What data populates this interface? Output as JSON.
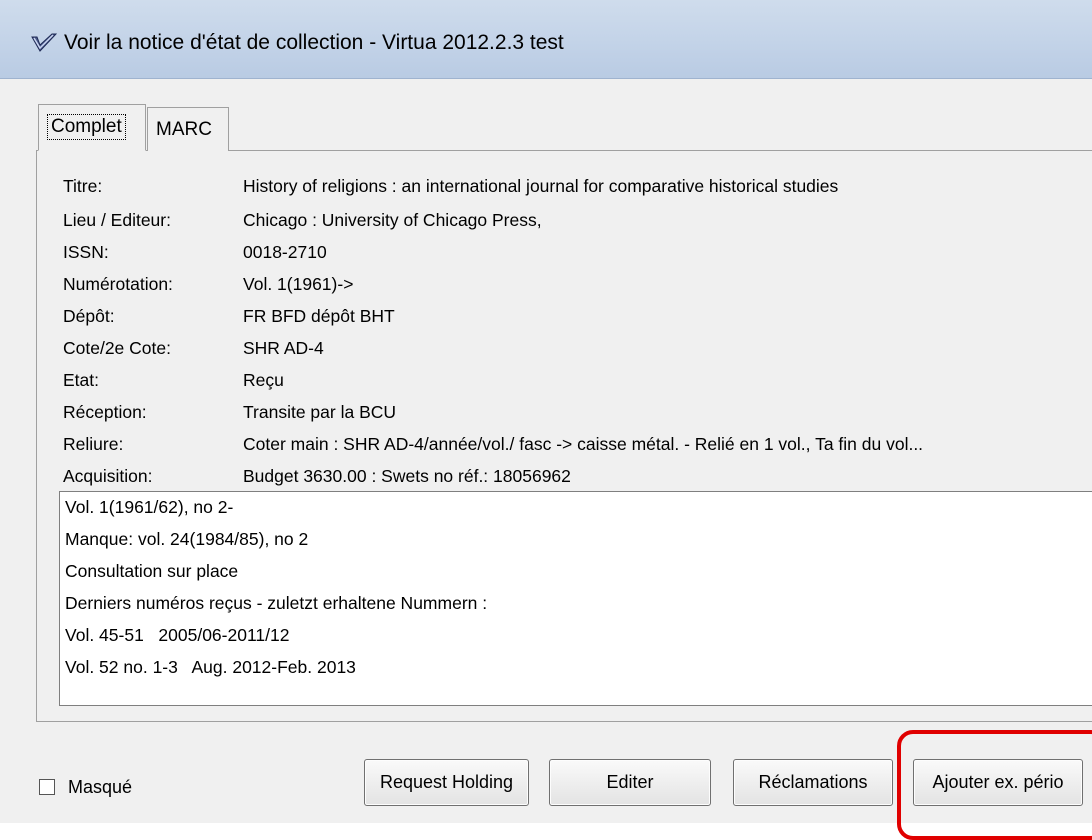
{
  "window": {
    "title": "Voir la notice d'état de collection - Virtua 2012.2.3 test",
    "icon": "virtua-checkmark-icon"
  },
  "tabs": [
    {
      "label": "Complet",
      "selected": true
    },
    {
      "label": "MARC",
      "selected": false
    }
  ],
  "fields": [
    {
      "label": "Titre:",
      "value": "History of religions : an international journal for comparative historical studies"
    },
    {
      "label": "Lieu / Editeur:",
      "value": "Chicago : University of Chicago Press,"
    },
    {
      "label": "ISSN:",
      "value": "0018-2710"
    },
    {
      "label": "Numérotation:",
      "value": "Vol. 1(1961)->"
    },
    {
      "label": "Dépôt:",
      "value": "FR BFD dépôt BHT"
    },
    {
      "label": "Cote/2e Cote:",
      "value": "SHR AD-4"
    },
    {
      "label": "Etat:",
      "value": "Reçu"
    },
    {
      "label": "Réception:",
      "value": "Transite par la BCU"
    },
    {
      "label": "Reliure:",
      "value": "Coter main : SHR  AD-4/année/vol./ fasc -> caisse métal. - Relié en 1 vol., Ta fin du vol..."
    },
    {
      "label": "Acquisition:",
      "value": "Budget 3630.00 : Swets no réf.: 18056962"
    }
  ],
  "notes": [
    "Vol. 1(1961/62), no 2-",
    "Manque: vol. 24(1984/85), no 2",
    "Consultation sur place",
    "Derniers numéros reçus - zuletzt erhaltene Nummern :",
    "Vol. 45-51   2005/06-2011/12",
    "Vol. 52 no. 1-3   Aug. 2012-Feb. 2013"
  ],
  "footer": {
    "masque_label": "Masqué",
    "masque_checked": false,
    "buttons": {
      "request_holding": "Request Holding",
      "editer": "Editer",
      "reclamations": "Réclamations",
      "ajouter": "Ajouter ex. pério"
    },
    "highlight_color": "#e00000"
  }
}
